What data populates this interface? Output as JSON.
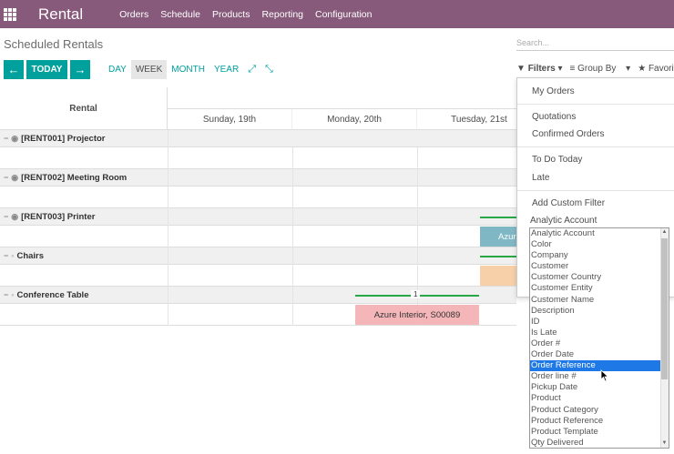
{
  "app": {
    "name": "Rental"
  },
  "nav": [
    "Orders",
    "Schedule",
    "Products",
    "Reporting",
    "Configuration"
  ],
  "page_title": "Scheduled Rentals",
  "search": {
    "placeholder": "Search..."
  },
  "buttons": {
    "prev": "←",
    "today": "TODAY",
    "next": "→"
  },
  "scales": [
    "DAY",
    "WEEK",
    "MONTH",
    "YEAR"
  ],
  "active_scale": "WEEK",
  "filter_bar": {
    "filters": "Filters",
    "group_by": "Group By",
    "favorites": "Favorite"
  },
  "gantt": {
    "header_label": "Rental",
    "days": [
      "Sunday, 19th",
      "Monday, 20th",
      "Tuesday, 21st"
    ],
    "groups": [
      {
        "label": "[RENT001] Projector"
      },
      {
        "label": "[RENT002] Meeting Room"
      },
      {
        "label": "[RENT003] Printer"
      },
      {
        "label": "Chairs"
      },
      {
        "label": "Conference Table"
      }
    ],
    "pills": {
      "printer": "Azur",
      "table": "Azure Interior, S00089"
    },
    "consolidation_count": "1"
  },
  "filters_dropdown": {
    "items": [
      "My Orders",
      "Quotations",
      "Confirmed Orders",
      "To Do Today",
      "Late",
      "Add Custom Filter"
    ],
    "selected_field": "Analytic Account"
  },
  "field_options": [
    "Analytic Account",
    "Color",
    "Company",
    "Customer",
    "Customer Country",
    "Customer Entity",
    "Customer Name",
    "Description",
    "ID",
    "Is Late",
    "Order #",
    "Order Date",
    "Order Reference",
    "Order line #",
    "Pickup Date",
    "Product",
    "Product Category",
    "Product Reference",
    "Product Template",
    "Qty Delivered"
  ],
  "highlighted_option": "Order Reference",
  "colors": {
    "navbar": "#875a7b",
    "accent": "#00a09d",
    "highlight": "#1e78e6"
  }
}
